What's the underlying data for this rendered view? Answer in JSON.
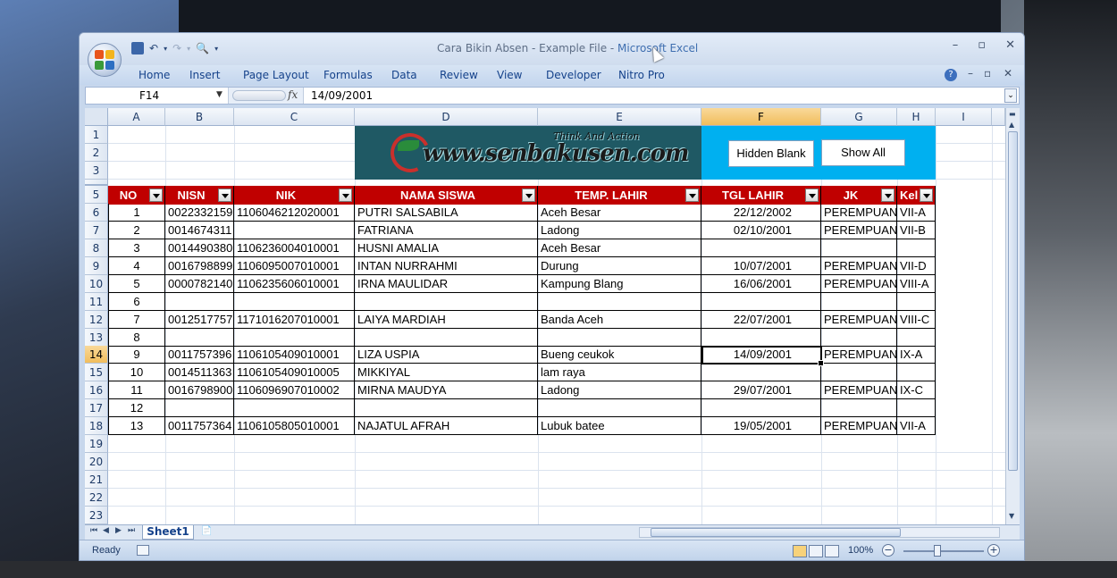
{
  "window": {
    "title_doc": "Cara Bikin Absen - Example File - ",
    "title_app": "Microsoft Excel"
  },
  "ribbon": {
    "tabs": [
      "Home",
      "Insert",
      "Page Layout",
      "Formulas",
      "Data",
      "Review",
      "View",
      "Developer",
      "Nitro Pro"
    ]
  },
  "formula_bar": {
    "name_box": "F14",
    "fx": "fx",
    "value": "14/09/2001"
  },
  "columns": [
    "A",
    "B",
    "C",
    "D",
    "E",
    "F",
    "G",
    "H",
    "I"
  ],
  "rows": [
    "1",
    "2",
    "3",
    "",
    "5",
    "6",
    "7",
    "8",
    "9",
    "10",
    "11",
    "12",
    "13",
    "14",
    "15",
    "16",
    "17",
    "18",
    "19",
    "20",
    "21",
    "22",
    "23"
  ],
  "banner": {
    "logo_text": "www.senbakusen.com",
    "tagline": "Think And Action"
  },
  "buttons": {
    "hidden_blank": "Hidden Blank",
    "show_all": "Show All"
  },
  "table": {
    "headers": [
      "NO",
      "NISN",
      "NIK",
      "NAMA SISWA",
      "TEMP. LAHIR",
      "TGL LAHIR",
      "JK",
      "Kel"
    ],
    "rows": [
      [
        "1",
        "0022332159",
        "1106046212020001",
        "PUTRI SALSABILA",
        "Aceh Besar",
        "22/12/2002",
        "PEREMPUAN",
        "VII-A"
      ],
      [
        "2",
        "0014674311",
        "",
        "FATRIANA",
        "Ladong",
        "02/10/2001",
        "PEREMPUAN",
        "VII-B"
      ],
      [
        "3",
        "0014490380",
        "1106236004010001",
        "HUSNI AMALIA",
        "Aceh Besar",
        "",
        "",
        ""
      ],
      [
        "4",
        "0016798899",
        "1106095007010001",
        "INTAN NURRAHMI",
        "Durung",
        "10/07/2001",
        "PEREMPUAN",
        "VII-D"
      ],
      [
        "5",
        "0000782140",
        "1106235606010001",
        "IRNA MAULIDAR",
        "Kampung Blang",
        "16/06/2001",
        "PEREMPUAN",
        "VIII-A"
      ],
      [
        "6",
        "",
        "",
        "",
        "",
        "",
        "",
        ""
      ],
      [
        "7",
        "0012517757",
        "1171016207010001",
        "LAIYA MARDIAH",
        "Banda Aceh",
        "22/07/2001",
        "PEREMPUAN",
        "VIII-C"
      ],
      [
        "8",
        "",
        "",
        "",
        "",
        "",
        "",
        ""
      ],
      [
        "9",
        "0011757396",
        "1106105409010001",
        "LIZA USPIA",
        "Bueng ceukok",
        "14/09/2001",
        "PEREMPUAN",
        "IX-A"
      ],
      [
        "10",
        "0014511363",
        "1106105409010005",
        "MIKKIYAL",
        "lam raya",
        "",
        "",
        ""
      ],
      [
        "11",
        "0016798900",
        "1106096907010002",
        "MIRNA MAUDYA",
        "Ladong",
        "29/07/2001",
        "PEREMPUAN",
        "IX-C"
      ],
      [
        "12",
        "",
        "",
        "",
        "",
        "",
        "",
        ""
      ],
      [
        "13",
        "0011757364",
        "1106105805010001",
        "NAJATUL AFRAH",
        "Lubuk batee",
        "19/05/2001",
        "PEREMPUAN",
        "VII-A"
      ]
    ]
  },
  "sheet_tabs": [
    "Sheet1"
  ],
  "status": {
    "ready": "Ready",
    "zoom": "100%"
  },
  "colors": {
    "header_red": "#c00000",
    "banner_teal": "#1f5964",
    "button_area_blue": "#00b0f0"
  }
}
